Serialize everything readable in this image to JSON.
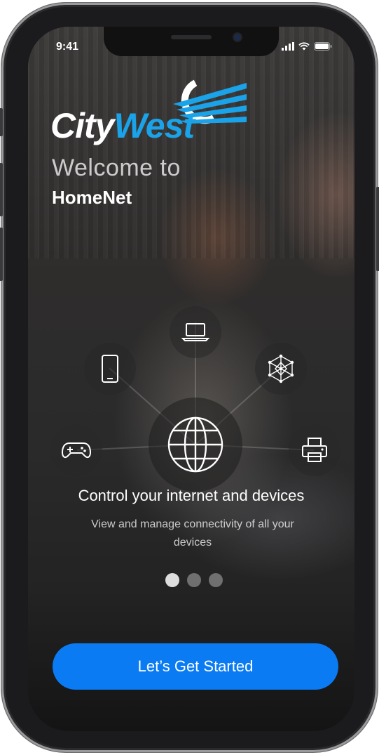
{
  "status_bar": {
    "time": "9:41",
    "icons": [
      "signal-icon",
      "wifi-icon",
      "battery-icon"
    ]
  },
  "logo": {
    "text_city": "City",
    "text_west": "West",
    "colors": {
      "city": "#ffffff",
      "west": "#1aa3e8"
    }
  },
  "welcome": {
    "line1": "Welcome to",
    "line2": "HomeNet"
  },
  "diagram": {
    "center_icon": "globe-icon",
    "devices": [
      "laptop-icon",
      "smartphone-icon",
      "network-icon",
      "gamepad-icon",
      "printer-icon"
    ]
  },
  "slide": {
    "title": "Control your internet and devices",
    "description": "View and manage connectivity of all your devices"
  },
  "pagination": {
    "count": 3,
    "active_index": 1
  },
  "cta": {
    "label": "Let’s Get Started",
    "color": "#0a7bf2"
  }
}
